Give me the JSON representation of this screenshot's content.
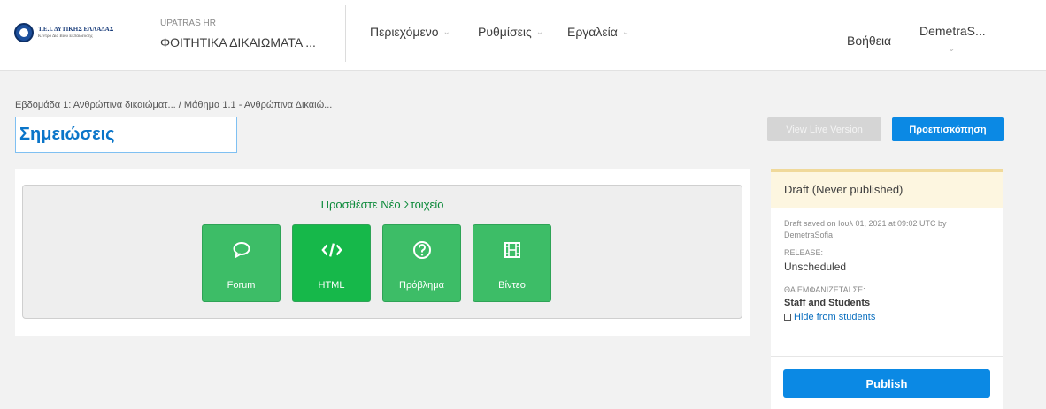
{
  "header": {
    "logo": {
      "line1": "Τ.Ε.Ι. ΔΥΤΙΚΗΣ ΕΛΛΑΔΑΣ",
      "line2": "Κέντρο Δια Βίου Εκπαίδευσης"
    },
    "course_org": "UPATRAS HR",
    "course_title": "ΦΟΙΤΗΤΙΚΑ ΔΙΚΑΙΩΜΑΤΑ ...",
    "nav": [
      {
        "label": "Περιεχόμενο"
      },
      {
        "label": "Ρυθμίσεις"
      },
      {
        "label": "Εργαλεία"
      }
    ],
    "help": "Βοήθεια",
    "user": "DemetraS..."
  },
  "breadcrumb": "Εβδομάδα 1: Ανθρώπινα δικαιώματ...  /  Μάθημα 1.1 - Ανθρώπινα Δικαιώ...",
  "unit_title": "Σημειώσεις",
  "buttons": {
    "view_live": "View Live Version",
    "preview": "Προεπισκόπηση"
  },
  "add_component": {
    "title": "Προσθέστε Νέο Στοιχείο",
    "items": [
      {
        "label": "Forum",
        "icon": "speech-bubble-icon"
      },
      {
        "label": "HTML",
        "icon": "code-icon"
      },
      {
        "label": "Πρόβλημα",
        "icon": "question-icon"
      },
      {
        "label": "Βίντεο",
        "icon": "film-icon"
      }
    ]
  },
  "sidebar": {
    "status": "Draft (Never published)",
    "saved_text": "Draft saved on Ιουλ 01, 2021 at 09:02 UTC by DemetraSofia",
    "release_label": "RELEASE:",
    "release_value": "Unscheduled",
    "visible_label": "ΘΑ ΕΜΦΑΝΙΖΕΤΑΙ ΣΕ:",
    "visible_value": "Staff and Students",
    "hide_label": "Hide from students",
    "publish": "Publish"
  },
  "colors": {
    "accent_blue": "#0b89e4",
    "component_green": "#3dbd67",
    "title_blue": "#0a75c9",
    "draft_bg": "#fdf6e0"
  }
}
